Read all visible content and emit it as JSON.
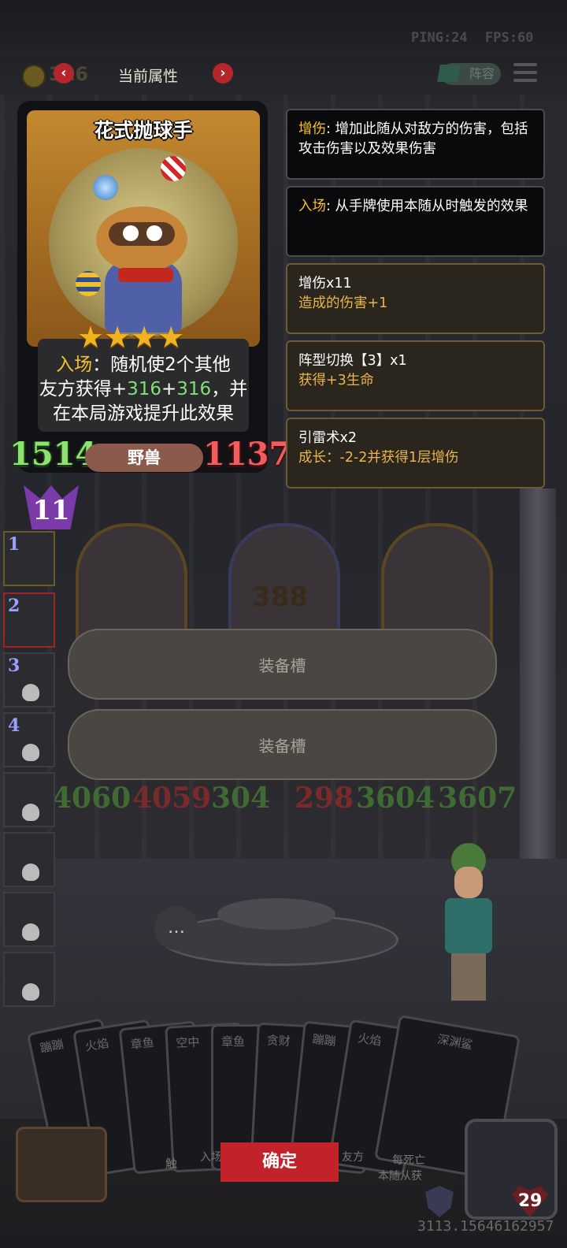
{
  "status": {
    "ping": "PING:24",
    "fps": "FPS:60"
  },
  "topbar": {
    "gold": "316",
    "title": "当前属性",
    "prev_symbol": "‹",
    "next_symbol": "›",
    "lineup_label": "阵容"
  },
  "card": {
    "name": "花式抛球手",
    "stars": 4,
    "effect_keyword": "入场",
    "effect_part1": "：随机使2个其他",
    "effect_part2": "友方获得+",
    "effect_num1": "316",
    "effect_plus": "+",
    "effect_num2": "316",
    "effect_part3": "，并",
    "effect_part4": "在本局游戏提升此效果",
    "attack": "1514",
    "health": "1137",
    "tribe": "野兽",
    "tier": "11"
  },
  "tooltips": [
    {
      "keyword": "增伤",
      "text": ": 增加此随从对敌方的伤害，包括攻击伤害以及效果伤害",
      "subtext": ""
    },
    {
      "keyword": "入场",
      "text": ": 从手牌使用本随从时触发的效果",
      "subtext": ""
    },
    {
      "keyword": "",
      "text": "增伤x11",
      "subtext": "造成的伤害+1"
    },
    {
      "keyword": "",
      "text": "阵型切换【3】x1",
      "subtext": "获得+3生命"
    },
    {
      "keyword": "",
      "text": "引雷术x2",
      "subtext": "成长：-2-2并获得1层增伤"
    }
  ],
  "board": {
    "damage_popup": "388",
    "equip_slot_1": "装备槽",
    "equip_slot_2": "装备槽",
    "stat_text_1": "4060",
    "stat_text_2": "4059",
    "stat_text_3": "304",
    "stat_text_4": "298",
    "stat_text_5": "3604",
    "stat_text_6": "3607"
  },
  "lineup_slots": [
    "1",
    "2",
    "3",
    "4",
    "",
    "",
    "",
    ""
  ],
  "hand": {
    "cards": [
      "蹦蹦",
      "火焰",
      "章鱼",
      "空中",
      "章鱼",
      "贪财",
      "蹦蹦",
      "火焰",
      "深渊鲨"
    ],
    "confirm_label": "确定",
    "card_text_1": "触",
    "card_text_2": "入场",
    "card_text_3": "友方",
    "card_text_4": "每死亡",
    "card_text_5": "本随从获"
  },
  "player": {
    "health": "29",
    "bottom_number": "3113.15646162957"
  }
}
